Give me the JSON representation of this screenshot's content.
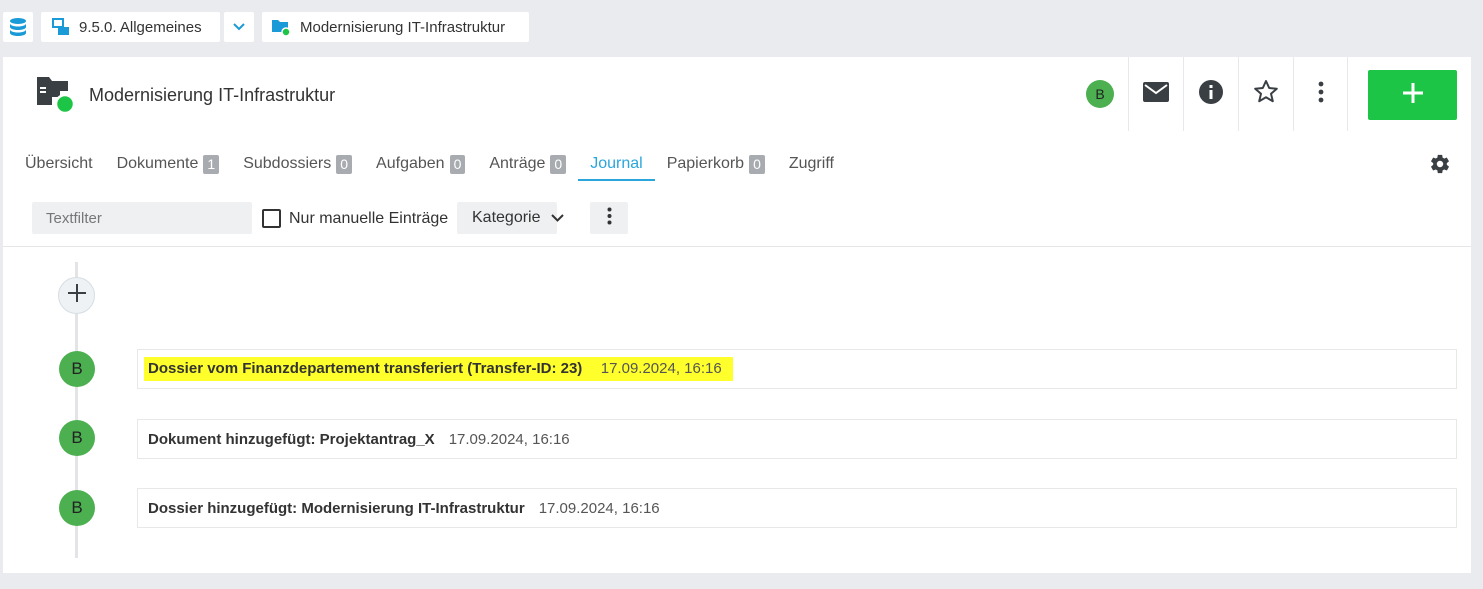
{
  "breadcrumbs": {
    "items": [
      {
        "label": "9.5.0. Allgemeines"
      },
      {
        "label": "Modernisierung IT-Infrastruktur"
      }
    ]
  },
  "header": {
    "title": "Modernisierung IT-Infrastruktur",
    "user_initial": "B"
  },
  "tabs": [
    {
      "label": "Übersicht",
      "count": null
    },
    {
      "label": "Dokumente",
      "count": "1"
    },
    {
      "label": "Subdossiers",
      "count": "0"
    },
    {
      "label": "Aufgaben",
      "count": "0"
    },
    {
      "label": "Anträge",
      "count": "0"
    },
    {
      "label": "Journal",
      "count": null,
      "active": true
    },
    {
      "label": "Papierkorb",
      "count": "0"
    },
    {
      "label": "Zugriff",
      "count": null
    }
  ],
  "filters": {
    "text_placeholder": "Textfilter",
    "manual_only_label": "Nur manuelle Einträge",
    "category_label": "Kategorie"
  },
  "journal": {
    "entries": [
      {
        "initial": "B",
        "title": "Dossier vom Finanzdepartement transferiert (Transfer-ID: 23)",
        "date": "17.09.2024, 16:16",
        "highlighted": true
      },
      {
        "initial": "B",
        "title": "Dokument hinzugefügt: Projektantrag_X",
        "date": "17.09.2024, 16:16",
        "highlighted": false
      },
      {
        "initial": "B",
        "title": "Dossier hinzugefügt: Modernisierung IT-Infrastruktur",
        "date": "17.09.2024, 16:16",
        "highlighted": false
      }
    ]
  },
  "colors": {
    "accent": "#2aa6dc",
    "add_button": "#1dc546",
    "avatar": "#4caf50",
    "highlight": "#ffff2b"
  },
  "icons": {
    "repository": "database-icon",
    "repo_folder": "repository-folder-icon",
    "dossier": "dossier-open-icon",
    "mail": "envelope-icon",
    "info": "info-icon",
    "favorite": "star-icon",
    "more": "more-vertical-icon",
    "add": "plus-icon",
    "settings": "gear-icon"
  }
}
